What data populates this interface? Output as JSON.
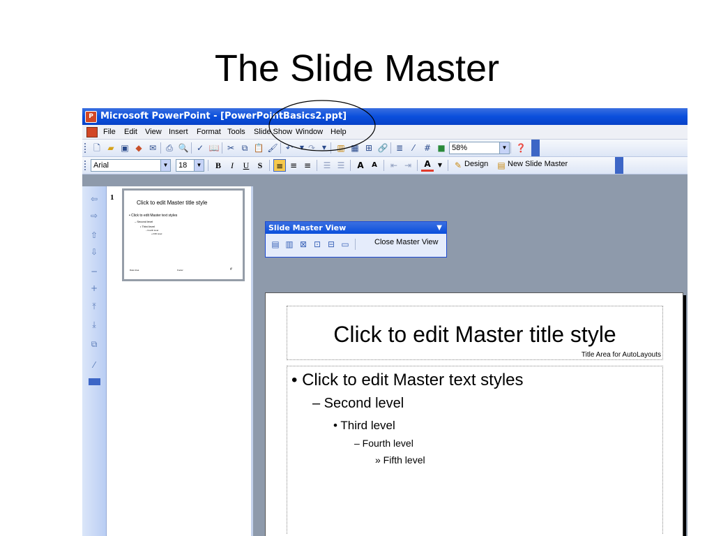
{
  "heading": "The Slide Master",
  "window": {
    "title": "Microsoft PowerPoint - [PowerPointBasics2.ppt]",
    "app_icon": "P"
  },
  "menu": [
    "File",
    "Edit",
    "View",
    "Insert",
    "Format",
    "Tools",
    "Slide Show",
    "Window",
    "Help"
  ],
  "format_toolbar": {
    "font": "Arial",
    "size": "18",
    "bold": "B",
    "italic": "I",
    "underline": "U",
    "shadow": "S",
    "design_label": "Design",
    "new_slide_master_label": "New Slide Master"
  },
  "standard_toolbar": {
    "zoom": "58%"
  },
  "thumbnail": {
    "number": "1",
    "title": "Click to edit Master title style",
    "l1": "• Click to edit Master text styles",
    "l2": "– Second level",
    "l3": "• Third level",
    "l4": "– Fourth level",
    "l5": "» Fifth level",
    "footer_left": "Date Area",
    "footer_mid": "Footer",
    "footer_right": "#"
  },
  "slide_master_toolbar": {
    "title": "Slide Master View",
    "close_label": "Close Master View"
  },
  "slide": {
    "title": "Click to edit Master title style",
    "title_area_label": "Title Area for AutoLayouts",
    "levels": [
      "•  Click to edit Master text styles",
      "– Second level",
      "• Third level",
      "– Fourth level",
      "» Fifth level"
    ]
  },
  "colors": {
    "titlebar": "#0a4fdc",
    "toolbar_bg": "#dde6f6",
    "workspace": "#8e9aab"
  }
}
